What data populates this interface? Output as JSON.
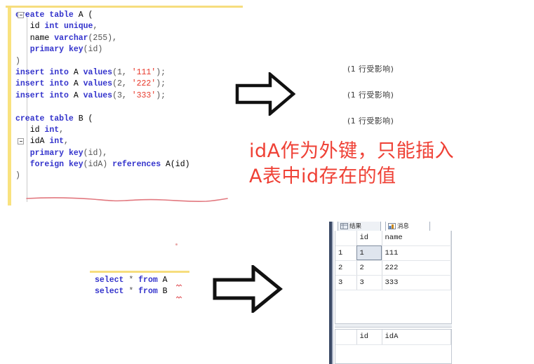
{
  "editor_top": {
    "lines": [
      [
        {
          "t": "create",
          "c": "kw"
        },
        {
          "t": " ",
          "c": "id"
        },
        {
          "t": "table",
          "c": "kw"
        },
        {
          "t": " A (",
          "c": "id"
        }
      ],
      [
        {
          "t": "   id ",
          "c": "id"
        },
        {
          "t": "int",
          "c": "kw"
        },
        {
          "t": " ",
          "c": "id"
        },
        {
          "t": "unique",
          "c": "kw"
        },
        {
          "t": ",",
          "c": "pun"
        }
      ],
      [
        {
          "t": "   name ",
          "c": "id"
        },
        {
          "t": "varchar",
          "c": "kw"
        },
        {
          "t": "(255),",
          "c": "pun"
        }
      ],
      [
        {
          "t": "   ",
          "c": "id"
        },
        {
          "t": "primary",
          "c": "kw"
        },
        {
          "t": " ",
          "c": "id"
        },
        {
          "t": "key",
          "c": "kw"
        },
        {
          "t": "(id)",
          "c": "pun"
        }
      ],
      [
        {
          "t": ")",
          "c": "pun"
        }
      ],
      [
        {
          "t": "insert",
          "c": "kw"
        },
        {
          "t": " ",
          "c": "id"
        },
        {
          "t": "into",
          "c": "kw"
        },
        {
          "t": " A ",
          "c": "id"
        },
        {
          "t": "values",
          "c": "kw"
        },
        {
          "t": "(1, ",
          "c": "pun"
        },
        {
          "t": "'111'",
          "c": "str"
        },
        {
          "t": ");",
          "c": "pun"
        }
      ],
      [
        {
          "t": "insert",
          "c": "kw"
        },
        {
          "t": " ",
          "c": "id"
        },
        {
          "t": "into",
          "c": "kw"
        },
        {
          "t": " A ",
          "c": "id"
        },
        {
          "t": "values",
          "c": "kw"
        },
        {
          "t": "(2, ",
          "c": "pun"
        },
        {
          "t": "'222'",
          "c": "str"
        },
        {
          "t": ");",
          "c": "pun"
        }
      ],
      [
        {
          "t": "insert",
          "c": "kw"
        },
        {
          "t": " ",
          "c": "id"
        },
        {
          "t": "into",
          "c": "kw"
        },
        {
          "t": " A ",
          "c": "id"
        },
        {
          "t": "values",
          "c": "kw"
        },
        {
          "t": "(3, ",
          "c": "pun"
        },
        {
          "t": "'333'",
          "c": "str"
        },
        {
          "t": ");",
          "c": "pun"
        }
      ],
      [],
      [
        {
          "t": "create",
          "c": "kw"
        },
        {
          "t": " ",
          "c": "id"
        },
        {
          "t": "table",
          "c": "kw"
        },
        {
          "t": " B (",
          "c": "id"
        }
      ],
      [
        {
          "t": "   id ",
          "c": "id"
        },
        {
          "t": "int",
          "c": "kw"
        },
        {
          "t": ",",
          "c": "pun"
        }
      ],
      [
        {
          "t": "   idA ",
          "c": "id"
        },
        {
          "t": "int",
          "c": "kw"
        },
        {
          "t": ",",
          "c": "pun"
        }
      ],
      [
        {
          "t": "   ",
          "c": "id"
        },
        {
          "t": "primary",
          "c": "kw"
        },
        {
          "t": " ",
          "c": "id"
        },
        {
          "t": "key",
          "c": "kw"
        },
        {
          "t": "(id),",
          "c": "pun"
        }
      ],
      [
        {
          "t": "   ",
          "c": "id"
        },
        {
          "t": "foreign",
          "c": "kw"
        },
        {
          "t": " ",
          "c": "id"
        },
        {
          "t": "key",
          "c": "kw"
        },
        {
          "t": "(idA) ",
          "c": "pun"
        },
        {
          "t": "references",
          "c": "kw"
        },
        {
          "t": " A(id)",
          "c": "id"
        }
      ],
      [
        {
          "t": ")",
          "c": "pun"
        }
      ]
    ]
  },
  "messages": {
    "lines": [
      "(1 行受影响)",
      "(1 行受影响)",
      "(1 行受影响)"
    ]
  },
  "annotation": {
    "line1": "idA作为外键，只能插入",
    "line2": "A表中id存在的值",
    "color": "#ef4136"
  },
  "editor_bottom": {
    "lines": [
      [
        {
          "t": "select",
          "c": "kw"
        },
        {
          "t": " ",
          "c": "id"
        },
        {
          "t": "*",
          "c": "pun"
        },
        {
          "t": " ",
          "c": "id"
        },
        {
          "t": "from",
          "c": "kw"
        },
        {
          "t": " A",
          "c": "id"
        }
      ],
      [
        {
          "t": "select",
          "c": "kw"
        },
        {
          "t": " ",
          "c": "id"
        },
        {
          "t": "*",
          "c": "pun"
        },
        {
          "t": " ",
          "c": "id"
        },
        {
          "t": "from",
          "c": "kw"
        },
        {
          "t": " B",
          "c": "id"
        }
      ]
    ]
  },
  "results": {
    "tabs": [
      {
        "label": "结果",
        "icon": "grid-icon",
        "active": false
      },
      {
        "label": "消息",
        "icon": "message-icon",
        "active": true
      }
    ],
    "grid_a": {
      "headers": [
        "",
        "id",
        "name"
      ],
      "rows": [
        {
          "num": "1",
          "id": "1",
          "name": "111",
          "selected": true
        },
        {
          "num": "2",
          "id": "2",
          "name": "222",
          "selected": false
        },
        {
          "num": "3",
          "id": "3",
          "name": "333",
          "selected": false
        }
      ]
    },
    "grid_b": {
      "headers": [
        "",
        "id",
        "idA"
      ],
      "rows": []
    }
  },
  "arrows": {
    "top_label": "right-arrow",
    "bottom_label": "right-arrow"
  }
}
